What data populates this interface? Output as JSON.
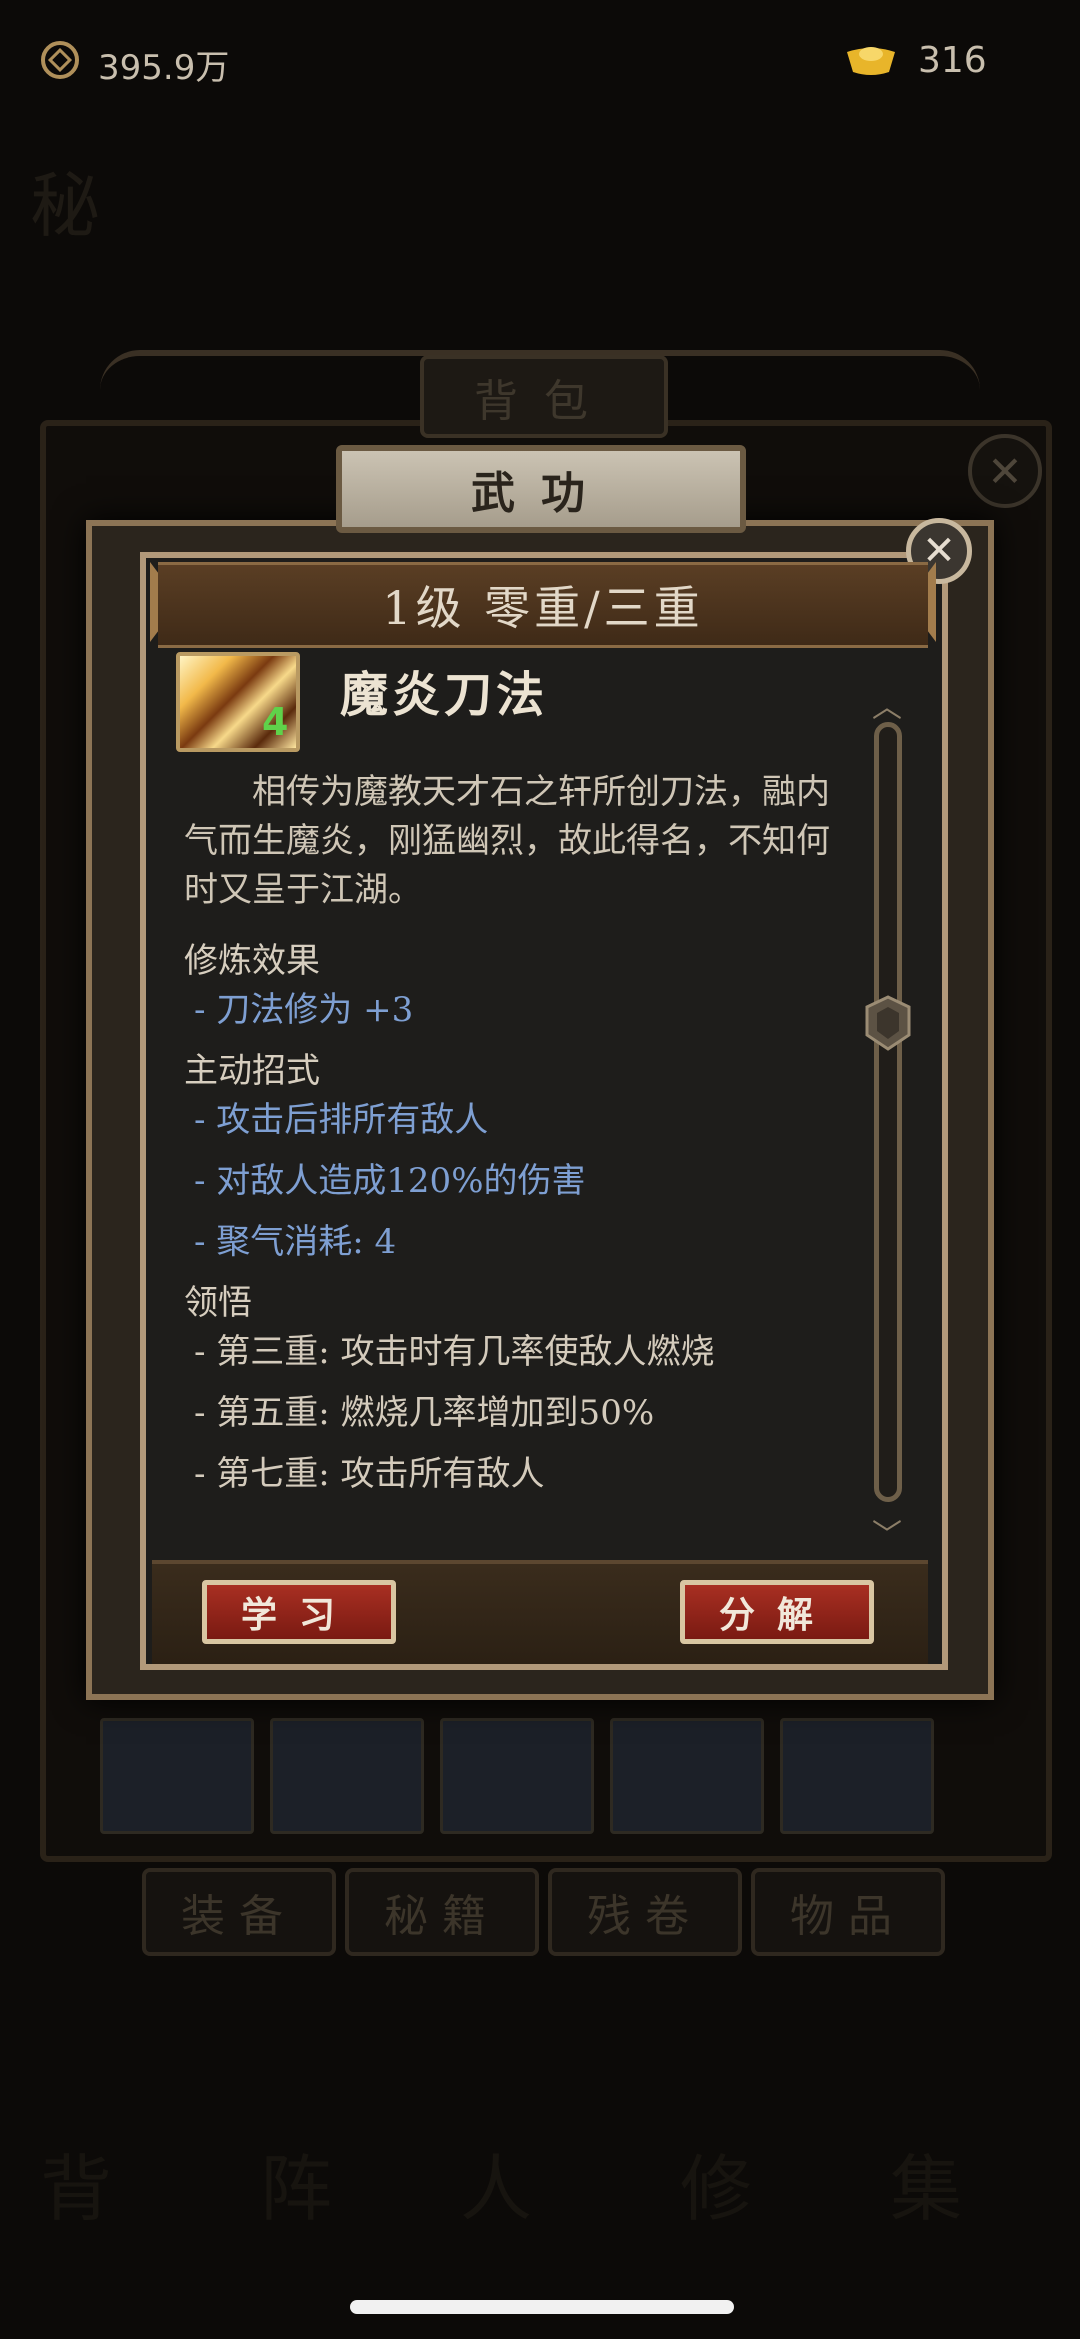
{
  "status": {
    "coins": "395.9万",
    "ingots": "316"
  },
  "background": {
    "tab_label": "背包",
    "bottom_tabs": [
      "装备",
      "秘籍",
      "残卷",
      "物品"
    ]
  },
  "dialog": {
    "header_tab": "武功",
    "level_banner": "1级 零重/三重",
    "skill_name": "魔炎刀法",
    "skill_icon_badge": "4",
    "description": "相传为魔教天才石之轩所创刀法，融内气而生魔炎，刚猛幽烈，故此得名，不知何时又呈于江湖。",
    "sections": [
      {
        "title": "修炼效果",
        "style": "blue",
        "items": [
          "- 刀法修为 +3"
        ]
      },
      {
        "title": "主动招式",
        "style": "blue",
        "items": [
          "- 攻击后排所有敌人",
          "- 对敌人造成120%的伤害",
          "- 聚气消耗: 4"
        ]
      },
      {
        "title": "领悟",
        "style": "plain",
        "items": [
          "- 第三重: 攻击时有几率使敌人燃烧",
          "- 第五重: 燃烧几率增加到50%",
          "- 第七重: 攻击所有敌人"
        ]
      }
    ],
    "buttons": {
      "learn": "学习",
      "decompose": "分解"
    }
  },
  "icons": [
    "coin-icon",
    "ingot-icon",
    "close-icon",
    "scroll-up-icon",
    "scroll-down-icon",
    "scroll-thumb-icon"
  ]
}
